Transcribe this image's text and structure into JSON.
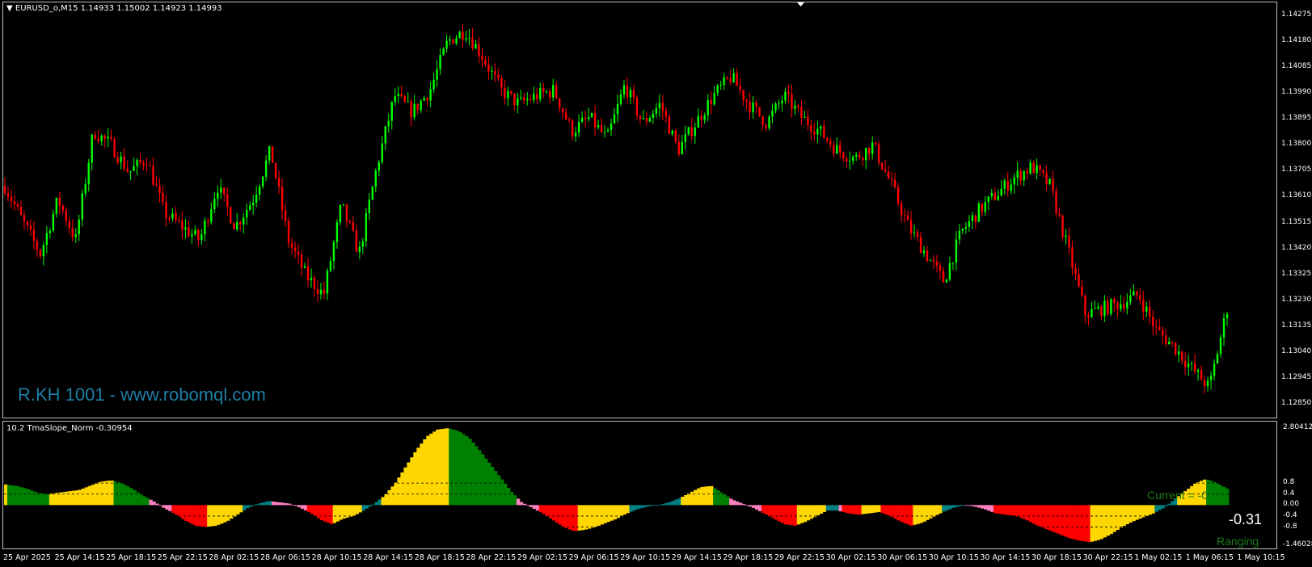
{
  "main_chart": {
    "header": "EURUSD_o,M15  1.14933 1.15002 1.14923 1.14993",
    "watermark": "R.KH 1001 - www.robomql.com",
    "price_labels": [
      "1.14275",
      "1.14180",
      "1.14085",
      "1.13990",
      "1.13895",
      "1.13800",
      "1.13705",
      "1.13610",
      "1.13515",
      "1.13420",
      "1.13325",
      "1.13230",
      "1.13135",
      "1.13040",
      "1.12945",
      "1.12850"
    ],
    "price_range": [
      1.1285,
      1.14275
    ],
    "colors": {
      "bull": "#00ff00",
      "bear": "#ff0000",
      "background": "#000000"
    }
  },
  "indicator": {
    "header": "10.2 TmaSlope_Norm -0.30954",
    "axis_labels": [
      "2.80412",
      "0.8",
      "0.4",
      "0.00",
      "-0.4",
      "-0.8",
      "-1.46028"
    ],
    "current_label": "Current = -0",
    "current_value": "-0.31",
    "state": "Ranging",
    "colors": {
      "strong_up": "#008000",
      "weak_up": "#ffd700",
      "strong_down": "#ff0000",
      "weak_down": "#ffd700",
      "neutral_up": "#008080",
      "neutral_down": "#ff80c0"
    }
  },
  "time_axis": [
    "25 Apr 2025",
    "25 Apr 14:15",
    "25 Apr 18:15",
    "25 Apr 22:15",
    "28 Apr 02:15",
    "28 Apr 06:15",
    "28 Apr 10:15",
    "28 Apr 14:15",
    "28 Apr 18:15",
    "28 Apr 22:15",
    "29 Apr 02:15",
    "29 Apr 06:15",
    "29 Apr 10:15",
    "29 Apr 14:15",
    "29 Apr 18:15",
    "29 Apr 22:15",
    "30 Apr 02:15",
    "30 Apr 06:15",
    "30 Apr 10:15",
    "30 Apr 14:15",
    "30 Apr 18:15",
    "30 Apr 22:15",
    "1 May 02:15",
    "1 May 06:15",
    "1 May 10:15"
  ],
  "chart_data": [
    {
      "type": "candlestick",
      "title": "EURUSD_o,M15",
      "ylim": [
        1.1285,
        1.14275
      ],
      "close_path": [
        1.1365,
        1.1352,
        1.134,
        1.136,
        1.1345,
        1.1385,
        1.138,
        1.137,
        1.1375,
        1.1355,
        1.135,
        1.1345,
        1.1365,
        1.135,
        1.136,
        1.1378,
        1.1345,
        1.1332,
        1.1325,
        1.1358,
        1.134,
        1.1372,
        1.1398,
        1.1392,
        1.14,
        1.1418,
        1.1422,
        1.1412,
        1.14,
        1.1395,
        1.1398,
        1.14,
        1.1385,
        1.139,
        1.1382,
        1.1402,
        1.1388,
        1.1395,
        1.1378,
        1.1388,
        1.1398,
        1.1405,
        1.1395,
        1.1388,
        1.1398,
        1.139,
        1.1385,
        1.1378,
        1.1375,
        1.138,
        1.1366,
        1.135,
        1.134,
        1.133,
        1.1348,
        1.1356,
        1.1362,
        1.1368,
        1.1372,
        1.1365,
        1.1342,
        1.1318,
        1.132,
        1.1322,
        1.1325,
        1.1312,
        1.1306,
        1.1298,
        1.1291,
        1.132
      ]
    },
    {
      "type": "bar",
      "title": "10.2 TmaSlope_Norm -0.30954",
      "ylim": [
        -1.46028,
        2.80412
      ],
      "values": [
        0.75,
        0.7,
        0.6,
        0.45,
        0.4,
        0.45,
        0.5,
        0.55,
        0.7,
        0.85,
        0.9,
        0.8,
        0.6,
        0.35,
        0.15,
        -0.1,
        -0.3,
        -0.55,
        -0.75,
        -0.8,
        -0.75,
        -0.6,
        -0.35,
        -0.1,
        0.05,
        0.15,
        0.1,
        0.05,
        -0.1,
        -0.3,
        -0.55,
        -0.7,
        -0.5,
        -0.4,
        -0.2,
        0.05,
        0.35,
        0.8,
        1.4,
        2.0,
        2.5,
        2.75,
        2.8,
        2.7,
        2.45,
        2.0,
        1.5,
        1.0,
        0.5,
        0.1,
        -0.1,
        -0.3,
        -0.55,
        -0.8,
        -0.95,
        -0.9,
        -0.8,
        -0.65,
        -0.5,
        -0.3,
        -0.15,
        -0.05,
        0.0,
        0.1,
        0.25,
        0.45,
        0.65,
        0.7,
        0.45,
        0.2,
        0.05,
        -0.1,
        -0.3,
        -0.5,
        -0.7,
        -0.75,
        -0.6,
        -0.4,
        -0.2,
        -0.2,
        -0.3,
        -0.35,
        -0.3,
        -0.25,
        -0.4,
        -0.6,
        -0.75,
        -0.65,
        -0.45,
        -0.25,
        -0.1,
        0.0,
        -0.05,
        -0.15,
        -0.3,
        -0.35,
        -0.4,
        -0.55,
        -0.75,
        -0.9,
        -1.05,
        -1.2,
        -1.3,
        -1.35,
        -1.25,
        -1.05,
        -0.8,
        -0.6,
        -0.45,
        -0.3,
        -0.1,
        0.2,
        0.5,
        0.8,
        0.95,
        0.8,
        0.6
      ]
    }
  ]
}
